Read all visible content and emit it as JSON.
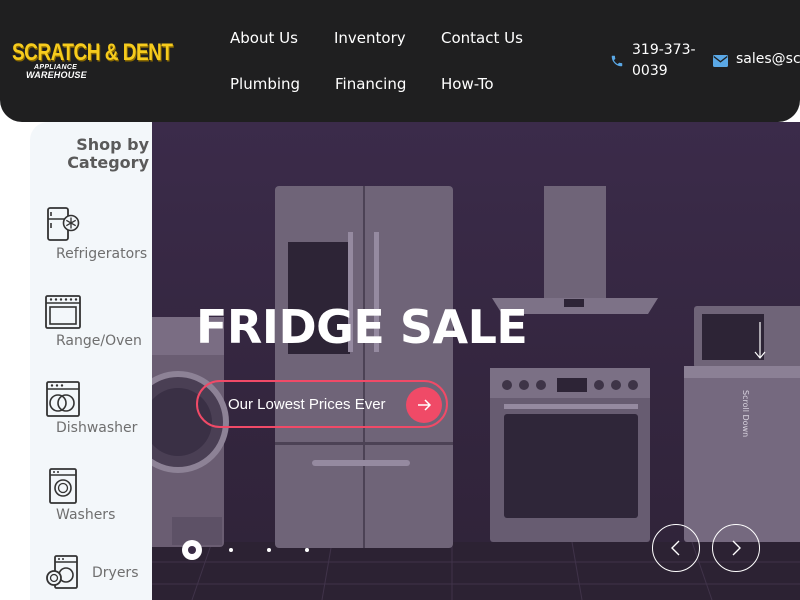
{
  "logo": {
    "line1": "SCRATCH & DENT",
    "line2": "APPLIANCE",
    "line3": "WAREHOUSE"
  },
  "nav": {
    "about": "About Us",
    "inventory": "Inventory",
    "contact": "Contact Us",
    "plumbing": "Plumbing",
    "financing": "Financing",
    "howto": "How-To"
  },
  "contact": {
    "phone": "319-373-0039",
    "email": "sales@sc"
  },
  "sidebar": {
    "title": "Shop by Category",
    "items": [
      {
        "label": "Refrigerators",
        "icon": "refrigerator-icon"
      },
      {
        "label": "Range/Oven",
        "icon": "range-oven-icon"
      },
      {
        "label": "Dishwasher",
        "icon": "dishwasher-icon"
      },
      {
        "label": "Washers",
        "icon": "washer-icon"
      },
      {
        "label": "Dryers",
        "icon": "dryer-icon"
      }
    ]
  },
  "hero": {
    "title": "FRIDGE SALE",
    "cta_label": "Our Lowest Prices Ever",
    "scroll_label": "Scroll Down",
    "slide_count": 4,
    "active_slide": 1
  },
  "colors": {
    "header_bg": "#1f1f20",
    "logo_yellow": "#f6cb1d",
    "accent_pink": "#f04a67",
    "phone_blue": "#5aa8e6",
    "hero_purple": "#3b2b4a",
    "sidebar_bg": "#f3f7fa"
  }
}
